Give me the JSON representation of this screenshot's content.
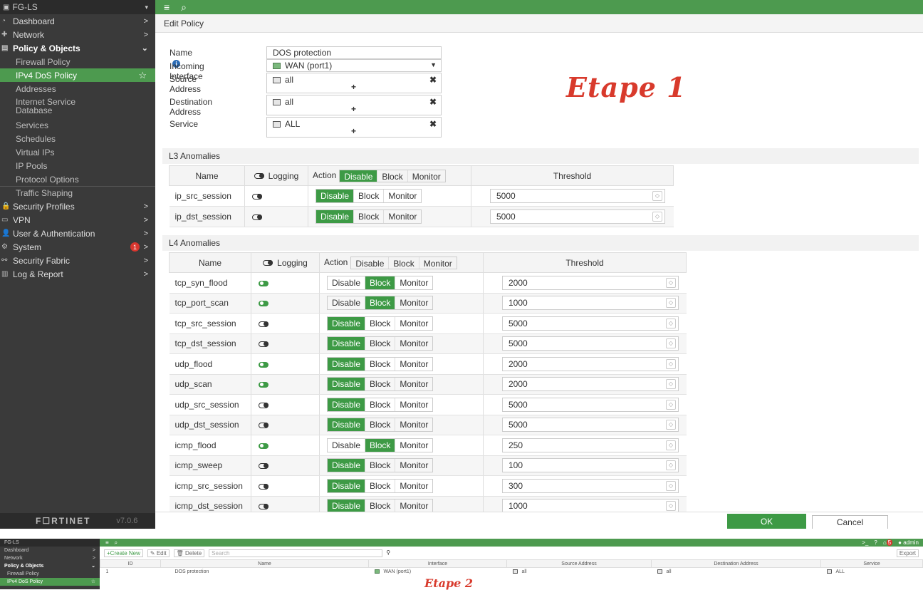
{
  "main": {
    "sidebar": {
      "header": "FG-LS",
      "items": [
        {
          "label": "Dashboard",
          "level": "top",
          "arrow": ">"
        },
        {
          "label": "Network",
          "level": "top",
          "arrow": ">"
        },
        {
          "label": "Policy & Objects",
          "level": "top",
          "arrow": "⌄"
        },
        {
          "label": "Firewall Policy",
          "level": "sub"
        },
        {
          "label": "IPv4 DoS Policy",
          "level": "sub",
          "active": true
        },
        {
          "label": "Addresses",
          "level": "sub"
        },
        {
          "label": "Internet Service Database",
          "level": "sub"
        },
        {
          "label": "Services",
          "level": "sub"
        },
        {
          "label": "Schedules",
          "level": "sub"
        },
        {
          "label": "Virtual IPs",
          "level": "sub"
        },
        {
          "label": "IP Pools",
          "level": "sub"
        },
        {
          "label": "Protocol Options",
          "level": "sub"
        },
        {
          "label": "Traffic Shaping",
          "level": "sub"
        },
        {
          "label": "Security Profiles",
          "level": "top",
          "arrow": ">"
        },
        {
          "label": "VPN",
          "level": "top",
          "arrow": ">"
        },
        {
          "label": "User & Authentication",
          "level": "top",
          "arrow": ">"
        },
        {
          "label": "System",
          "level": "top",
          "arrow": ">",
          "badge": "1"
        },
        {
          "label": "Security Fabric",
          "level": "top",
          "arrow": ">"
        },
        {
          "label": "Log & Report",
          "level": "top",
          "arrow": ">"
        }
      ],
      "brand": "F☐RTINET",
      "version": "v7.0.6"
    },
    "page_title": "Edit Policy",
    "form": {
      "name_label": "Name",
      "name_value": "DOS protection",
      "incoming_label": "Incoming Interface",
      "incoming_value": "WAN (port1)",
      "src_label": "Source Address",
      "src_value": "all",
      "dst_label": "Destination Address",
      "dst_value": "all",
      "service_label": "Service",
      "service_value": "ALL"
    },
    "etape1": "Etape 1",
    "l3": {
      "title": "L3 Anomalies",
      "col_name": "Name",
      "col_logging": "Logging",
      "col_action": "Action",
      "col_threshold": "Threshold",
      "rows": [
        {
          "name": "ip_src_session",
          "logging": false,
          "action": "Disable",
          "threshold": "5000"
        },
        {
          "name": "ip_dst_session",
          "logging": false,
          "action": "Disable",
          "threshold": "5000"
        }
      ]
    },
    "l4": {
      "title": "L4 Anomalies",
      "col_name": "Name",
      "col_logging": "Logging",
      "col_action": "Action",
      "col_threshold": "Threshold",
      "rows": [
        {
          "name": "tcp_syn_flood",
          "logging": true,
          "action": "Block",
          "threshold": "2000"
        },
        {
          "name": "tcp_port_scan",
          "logging": true,
          "action": "Block",
          "threshold": "1000"
        },
        {
          "name": "tcp_src_session",
          "logging": false,
          "action": "Disable",
          "threshold": "5000"
        },
        {
          "name": "tcp_dst_session",
          "logging": false,
          "action": "Disable",
          "threshold": "5000"
        },
        {
          "name": "udp_flood",
          "logging": true,
          "action": "Disable",
          "threshold": "2000"
        },
        {
          "name": "udp_scan",
          "logging": true,
          "action": "Disable",
          "threshold": "2000"
        },
        {
          "name": "udp_src_session",
          "logging": false,
          "action": "Disable",
          "threshold": "5000"
        },
        {
          "name": "udp_dst_session",
          "logging": false,
          "action": "Disable",
          "threshold": "5000"
        },
        {
          "name": "icmp_flood",
          "logging": true,
          "action": "Block",
          "threshold": "250"
        },
        {
          "name": "icmp_sweep",
          "logging": false,
          "action": "Disable",
          "threshold": "100"
        },
        {
          "name": "icmp_src_session",
          "logging": false,
          "action": "Disable",
          "threshold": "300"
        },
        {
          "name": "icmp_dst_session",
          "logging": false,
          "action": "Disable",
          "threshold": "1000"
        }
      ]
    },
    "action_options": [
      "Disable",
      "Block",
      "Monitor"
    ],
    "ok_label": "OK",
    "cancel_label": "Cancel"
  },
  "list_view": {
    "sidebar": {
      "header": "FG-LS",
      "items": [
        "Dashboard",
        "Network",
        "Policy & Objects",
        "Firewall Policy",
        "IPv4 DoS Policy"
      ]
    },
    "toolbar": {
      "create_label": "+Create New",
      "edit_label": "✎ Edit",
      "delete_label": "🗑 Delete",
      "search_placeholder": "Search",
      "export_label": "Export",
      "user": "admin",
      "notif_count": "5"
    },
    "columns": [
      "ID",
      "Name",
      "Interface",
      "Source Address",
      "Destination Address",
      "Service"
    ],
    "row": {
      "id": "1",
      "name": "DOS protection",
      "interface": "WAN (port1)",
      "source": "all",
      "destination": "all",
      "service": "ALL"
    },
    "etape2": "Etape 2"
  },
  "colors": {
    "accent": "#4d9a4f",
    "toggle_on": "#3d9a45",
    "annotation": "#d83a2c",
    "sidebar_bg": "#3a3a3a"
  }
}
